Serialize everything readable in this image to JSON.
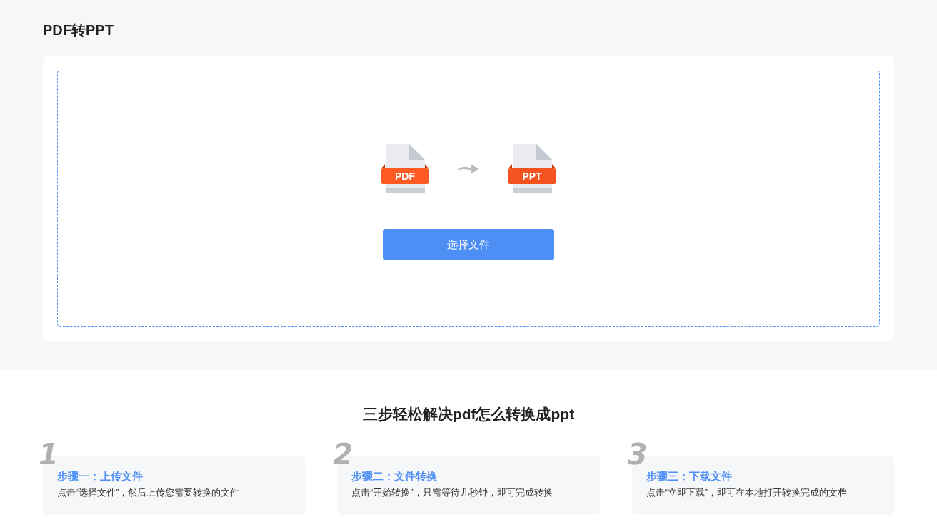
{
  "page_title": "PDF转PPT",
  "converter": {
    "source_label": "PDF",
    "target_label": "PPT",
    "button": "选择文件"
  },
  "steps_heading": "三步轻松解决pdf怎么转换成ppt",
  "steps": [
    {
      "number": "1",
      "title": "步骤一：上传文件",
      "description": "点击“选择文件”，然后上传您需要转换的文件"
    },
    {
      "number": "2",
      "title": "步骤二：文件转换",
      "description": "点击“开始转换”，只需等待几秒钟，即可完成转换"
    },
    {
      "number": "3",
      "title": "步骤三：下载文件",
      "description": "点击“立即下载”，即可在本地打开转换完成的文档"
    }
  ]
}
